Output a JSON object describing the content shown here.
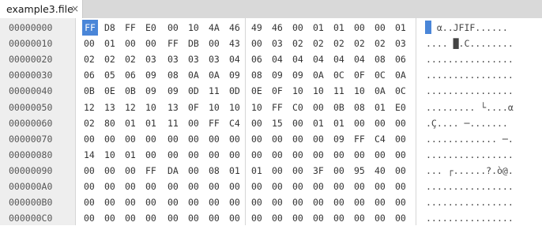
{
  "tab": {
    "filename": "example3.file",
    "close_glyph": "×"
  },
  "colors": {
    "selection": "#4a86d8",
    "tabbar_bg": "#d9d9d9",
    "offset_bg": "#eeeeee"
  },
  "rows": [
    {
      "offset": "00000000",
      "bytes": [
        "FF",
        "D8",
        "FF",
        "E0",
        "00",
        "10",
        "4A",
        "46",
        "49",
        "46",
        "00",
        "01",
        "01",
        "00",
        "00",
        "01"
      ],
      "ascii": "  α..JFIF......"
    },
    {
      "offset": "00000010",
      "bytes": [
        "00",
        "01",
        "00",
        "00",
        "FF",
        "DB",
        "00",
        "43",
        "00",
        "03",
        "02",
        "02",
        "02",
        "02",
        "02",
        "03"
      ],
      "ascii": ".... █.C........"
    },
    {
      "offset": "00000020",
      "bytes": [
        "02",
        "02",
        "02",
        "03",
        "03",
        "03",
        "03",
        "04",
        "06",
        "04",
        "04",
        "04",
        "04",
        "04",
        "08",
        "06"
      ],
      "ascii": "................"
    },
    {
      "offset": "00000030",
      "bytes": [
        "06",
        "05",
        "06",
        "09",
        "08",
        "0A",
        "0A",
        "09",
        "08",
        "09",
        "09",
        "0A",
        "0C",
        "0F",
        "0C",
        "0A"
      ],
      "ascii": "................"
    },
    {
      "offset": "00000040",
      "bytes": [
        "0B",
        "0E",
        "0B",
        "09",
        "09",
        "0D",
        "11",
        "0D",
        "0E",
        "0F",
        "10",
        "10",
        "11",
        "10",
        "0A",
        "0C"
      ],
      "ascii": "................"
    },
    {
      "offset": "00000050",
      "bytes": [
        "12",
        "13",
        "12",
        "10",
        "13",
        "0F",
        "10",
        "10",
        "10",
        "FF",
        "C0",
        "00",
        "0B",
        "08",
        "01",
        "E0"
      ],
      "ascii": "......... └....α"
    },
    {
      "offset": "00000060",
      "bytes": [
        "02",
        "80",
        "01",
        "01",
        "11",
        "00",
        "FF",
        "C4",
        "00",
        "15",
        "00",
        "01",
        "01",
        "00",
        "00",
        "00"
      ],
      "ascii": ".Ç.... ─......."
    },
    {
      "offset": "00000070",
      "bytes": [
        "00",
        "00",
        "00",
        "00",
        "00",
        "00",
        "00",
        "00",
        "00",
        "00",
        "00",
        "00",
        "09",
        "FF",
        "C4",
        "00"
      ],
      "ascii": "............. ─."
    },
    {
      "offset": "00000080",
      "bytes": [
        "14",
        "10",
        "01",
        "00",
        "00",
        "00",
        "00",
        "00",
        "00",
        "00",
        "00",
        "00",
        "00",
        "00",
        "00",
        "00"
      ],
      "ascii": "................"
    },
    {
      "offset": "00000090",
      "bytes": [
        "00",
        "00",
        "00",
        "FF",
        "DA",
        "00",
        "08",
        "01",
        "01",
        "00",
        "00",
        "3F",
        "00",
        "95",
        "40",
        "00"
      ],
      "ascii": "... ┌......?.ò@."
    },
    {
      "offset": "000000A0",
      "bytes": [
        "00",
        "00",
        "00",
        "00",
        "00",
        "00",
        "00",
        "00",
        "00",
        "00",
        "00",
        "00",
        "00",
        "00",
        "00",
        "00"
      ],
      "ascii": "................"
    },
    {
      "offset": "000000B0",
      "bytes": [
        "00",
        "00",
        "00",
        "00",
        "00",
        "00",
        "00",
        "00",
        "00",
        "00",
        "00",
        "00",
        "00",
        "00",
        "00",
        "00"
      ],
      "ascii": "................"
    },
    {
      "offset": "000000C0",
      "bytes": [
        "00",
        "00",
        "00",
        "00",
        "00",
        "00",
        "00",
        "00",
        "00",
        "00",
        "00",
        "00",
        "00",
        "00",
        "00",
        "00"
      ],
      "ascii": "................"
    }
  ]
}
